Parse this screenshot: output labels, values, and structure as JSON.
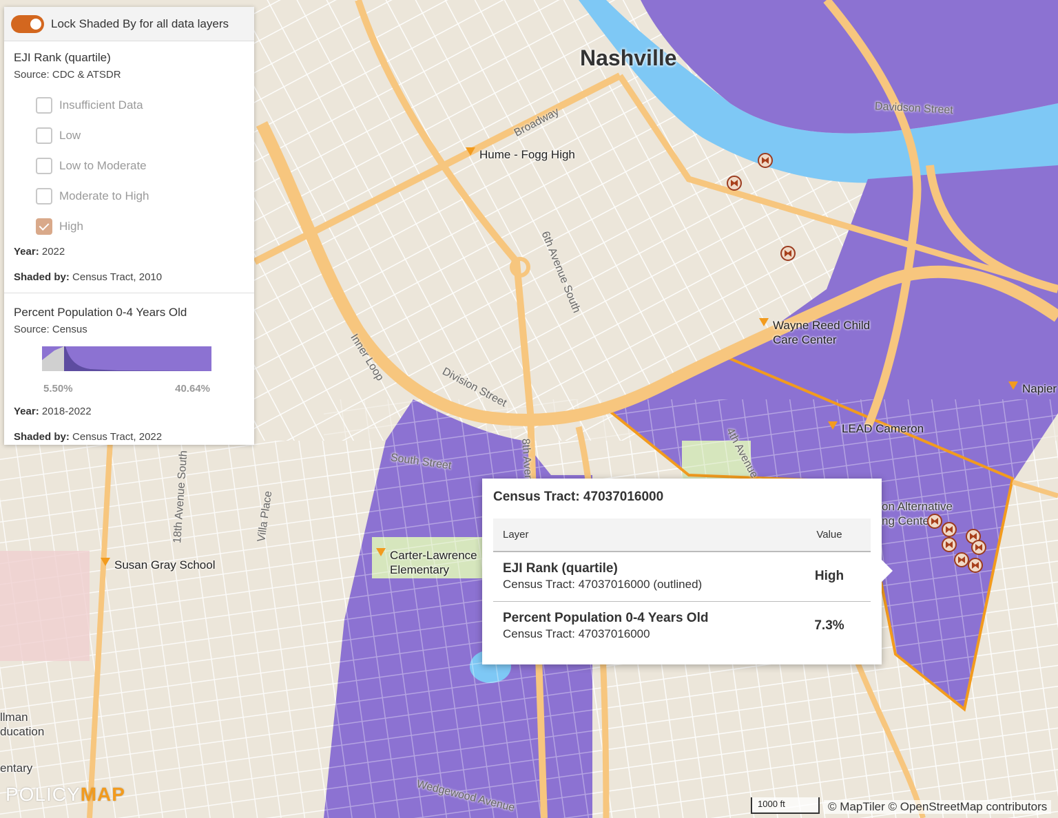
{
  "legend": {
    "lock_label": "Lock Shaded By for all data layers",
    "layer1": {
      "title": "EJI Rank (quartile)",
      "source": "Source: CDC & ATSDR",
      "categories": [
        {
          "label": "Insufficient Data",
          "checked": false
        },
        {
          "label": "Low",
          "checked": false
        },
        {
          "label": "Low to Moderate",
          "checked": false
        },
        {
          "label": "Moderate to High",
          "checked": false
        },
        {
          "label": "High",
          "checked": true
        }
      ],
      "year_label": "Year:",
      "year_value": " 2022",
      "shaded_label": "Shaded by:",
      "shaded_value": " Census Tract, 2010"
    },
    "layer2": {
      "title": "Percent Population 0-4 Years Old",
      "source": "Source: Census",
      "ramp_min": "5.50%",
      "ramp_max": "40.64%",
      "ramp_color": "#8c72d2",
      "year_label": "Year:",
      "year_value": " 2018-2022",
      "shaded_label": "Shaded by:",
      "shaded_value": " Census Tract, 2022"
    }
  },
  "popup": {
    "title": "Census Tract: 47037016000",
    "col_layer": "Layer",
    "col_value": "Value",
    "rows": [
      {
        "layer": "EJI Rank (quartile)",
        "sub": "Census Tract: 47037016000 (outlined)",
        "value": "High"
      },
      {
        "layer": "Percent Population 0-4 Years Old",
        "sub": "Census Tract: 47037016000",
        "value": "7.3%"
      }
    ]
  },
  "map": {
    "city": "Nashville",
    "pois": [
      {
        "name": "Hume - Fogg High"
      },
      {
        "name": "Wayne Reed Child\nCare Center"
      },
      {
        "name": "LEAD Cameron"
      },
      {
        "name": "Napier"
      },
      {
        "name": "Susan Gray School"
      },
      {
        "name": "Carter-Lawrence\nElementary"
      }
    ],
    "streets": [
      "Broadway",
      "6th Avenue South",
      "Davidson Street",
      "Inner Loop",
      "Division Street",
      "4th Avenue S",
      "South Street",
      "8th Aven",
      "18th Avenue South",
      "Villa Place",
      "Wedgewood Avenue"
    ],
    "fragments": [
      "on Alternative",
      "ng Center",
      "llman",
      "ducation",
      "entary"
    ],
    "colors": {
      "shade": "#8c72d2",
      "outline": "#f29b1e",
      "water": "#7ec8f5",
      "road": "#f7c67e",
      "base": "#ece6da"
    }
  },
  "footer": {
    "logo_light": "POLICY",
    "logo_bold": "MAP",
    "scale": "1000 ft",
    "attribution": "© MapTiler © OpenStreetMap contributors"
  }
}
